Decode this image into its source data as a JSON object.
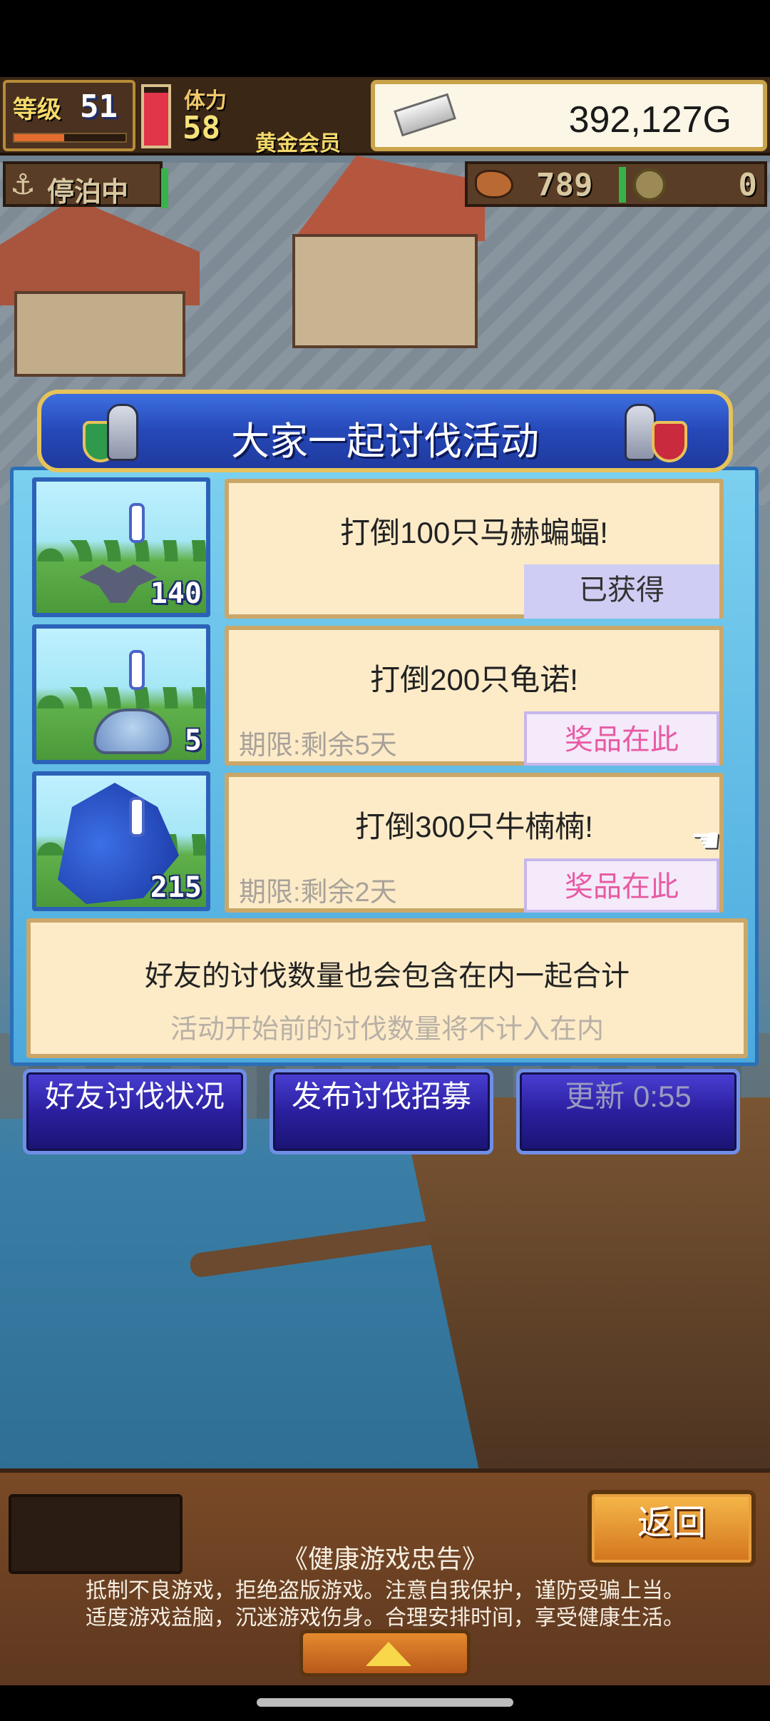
{
  "hud": {
    "level_label": "等级",
    "level": "51",
    "level_progress": 0.45,
    "stamina_label": "体力",
    "stamina": "58",
    "stamina_fill": 0.9,
    "membership": "黄金会员",
    "gold": "392,127G",
    "dock_status": "停泊中",
    "food": "789",
    "coins": "0"
  },
  "event": {
    "title": "大家一起讨伐活动",
    "items": [
      {
        "title": "打倒100只马赫蝙蝠!",
        "deadline": "",
        "button": "已获得",
        "button_state": "claimed",
        "count": "140",
        "icon": "bat-monster"
      },
      {
        "title": "打倒200只龟诺!",
        "deadline": "期限:剩余5天",
        "button": "奖品在此",
        "button_state": "prize",
        "count": "5",
        "icon": "turtle-monster"
      },
      {
        "title": "打倒300只牛楠楠!",
        "deadline": "期限:剩余2天",
        "button": "奖品在此",
        "button_state": "prize",
        "count": "215",
        "icon": "beast-monster"
      }
    ],
    "info_line1": "好友的讨伐数量也会包含在内一起合计",
    "info_line2": "活动开始前的讨伐数量将不计入在内"
  },
  "actions": {
    "friends_status": "好友讨伐状况",
    "post_recruit": "发布讨伐招募",
    "refresh": "更新 0:55"
  },
  "bottom": {
    "back": "返回",
    "notice_title": "《健康游戏忠告》",
    "notice_line1": "抵制不良游戏，拒绝盗版游戏。注意自我保护，谨防受骗上当。",
    "notice_line2": "适度游戏益脑，沉迷游戏伤身。合理安排时间，享受健康生活。"
  },
  "colors": {
    "panel_blue": "#2648b8",
    "card_bg": "#fdebc8",
    "prize_pink": "#e85aa3",
    "claimed_lavender": "#cfcdf3",
    "gold_border": "#e6c35a"
  }
}
